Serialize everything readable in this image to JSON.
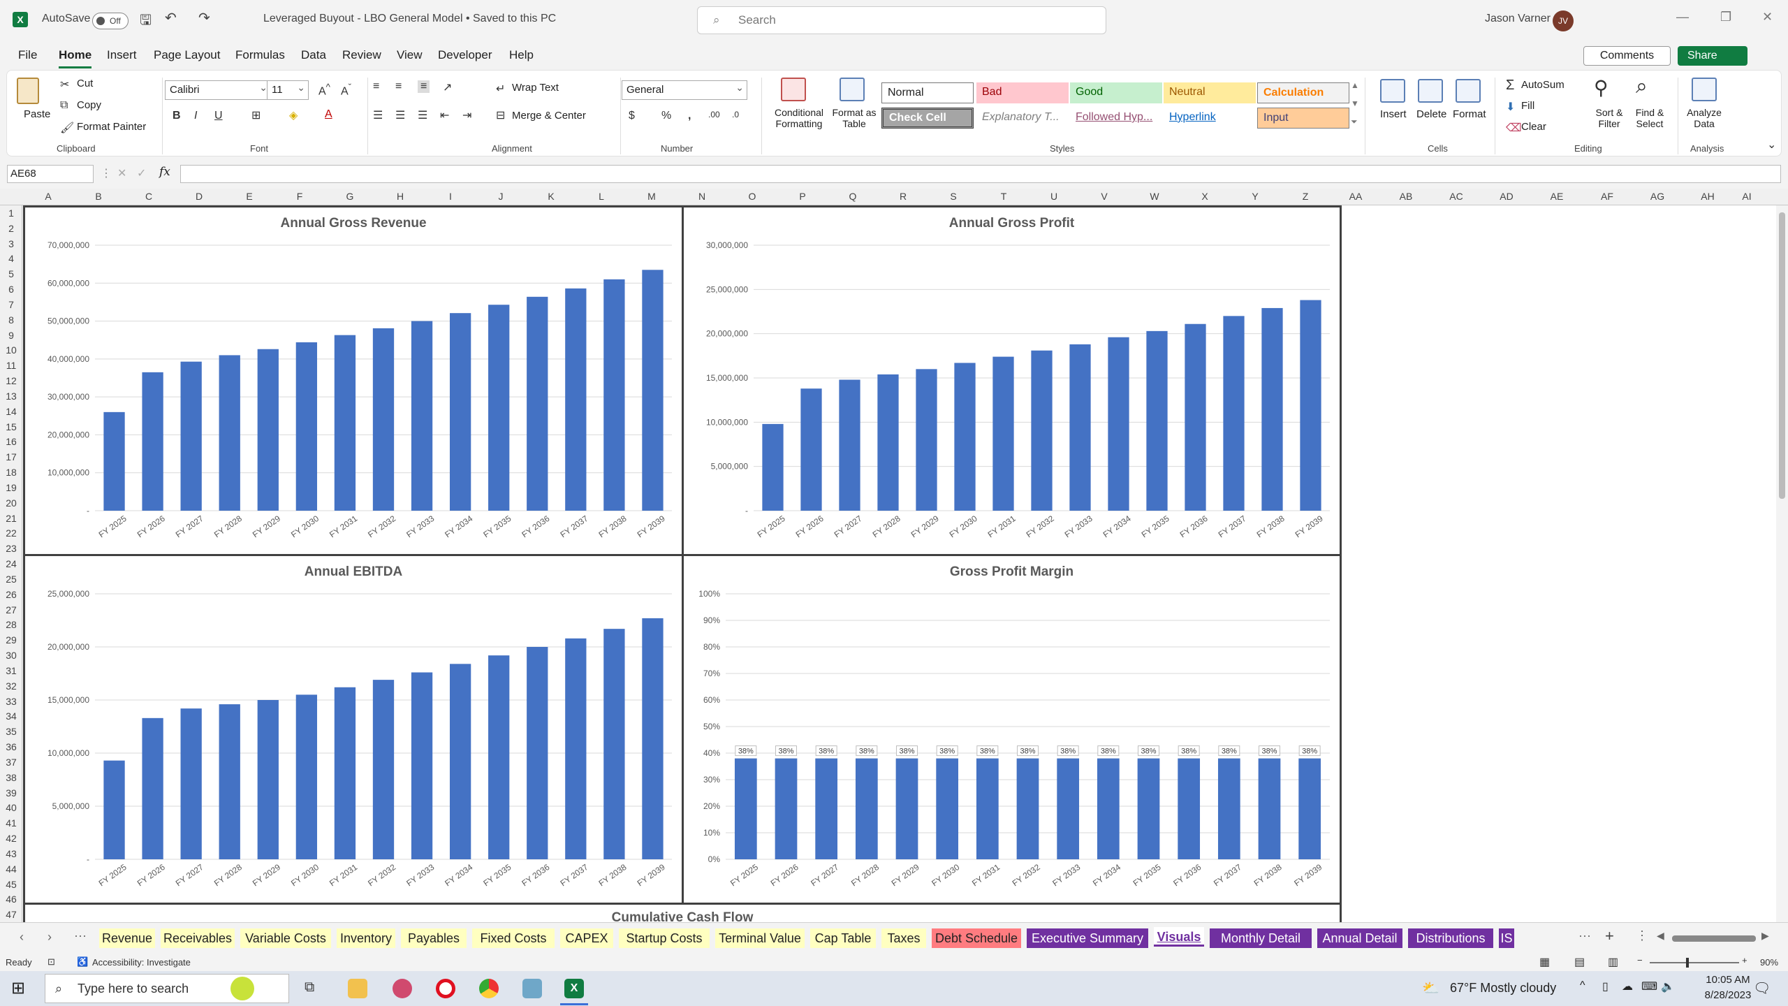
{
  "titlebar": {
    "autosave_label": "AutoSave",
    "autosave_state": "Off",
    "document_title": "Leveraged Buyout - LBO General Model  •  Saved to this PC",
    "search_placeholder": "Search",
    "user_name": "Jason Varner",
    "user_initials": "JV"
  },
  "menu": {
    "items": [
      "File",
      "Home",
      "Insert",
      "Page Layout",
      "Formulas",
      "Data",
      "Review",
      "View",
      "Developer",
      "Help"
    ],
    "active": "Home",
    "comments_label": "Comments",
    "share_label": "Share"
  },
  "ribbon": {
    "clipboard": {
      "paste": "Paste",
      "cut": "Cut",
      "copy": "Copy",
      "format_painter": "Format Painter",
      "group": "Clipboard"
    },
    "font": {
      "name": "Calibri",
      "size": "11",
      "group": "Font"
    },
    "alignment": {
      "wrap_text": "Wrap Text",
      "merge_center": "Merge & Center",
      "group": "Alignment"
    },
    "number": {
      "format": "General",
      "group": "Number"
    },
    "styles": {
      "conditional_formatting": "Conditional Formatting",
      "format_as_table": "Format as Table",
      "cells": [
        "Normal",
        "Bad",
        "Good",
        "Neutral",
        "Calculation",
        "Check Cell",
        "Explanatory T...",
        "Followed Hyp...",
        "Hyperlink",
        "Input"
      ],
      "group": "Styles"
    },
    "cells": {
      "insert": "Insert",
      "delete": "Delete",
      "format": "Format",
      "group": "Cells"
    },
    "editing": {
      "autosum": "AutoSum",
      "fill": "Fill",
      "clear": "Clear",
      "sort_filter": "Sort & Filter",
      "find_select": "Find & Select",
      "group": "Editing"
    },
    "analysis": {
      "analyze_data": "Analyze Data",
      "group": "Analysis"
    }
  },
  "formula_bar": {
    "name_box": "AE68",
    "formula": ""
  },
  "columns": [
    "A",
    "B",
    "C",
    "D",
    "E",
    "F",
    "G",
    "H",
    "I",
    "J",
    "K",
    "L",
    "M",
    "N",
    "O",
    "P",
    "Q",
    "R",
    "S",
    "T",
    "U",
    "V",
    "W",
    "X",
    "Y",
    "Z",
    "AA",
    "AB",
    "AC",
    "AD",
    "AE",
    "AF",
    "AG",
    "AH",
    "AI"
  ],
  "rows": [
    "1",
    "2",
    "3",
    "4",
    "5",
    "6",
    "7",
    "8",
    "9",
    "10",
    "11",
    "12",
    "13",
    "14",
    "15",
    "16",
    "17",
    "18",
    "19",
    "20",
    "21",
    "22",
    "23",
    "24",
    "25",
    "26",
    "27",
    "28",
    "29",
    "30",
    "31",
    "32",
    "33",
    "34",
    "35",
    "36",
    "37",
    "38",
    "39",
    "40",
    "41",
    "42",
    "43",
    "44",
    "45",
    "46",
    "47"
  ],
  "chart_data": [
    {
      "type": "bar",
      "title": "Annual Gross Revenue",
      "categories": [
        "FY 2025",
        "FY 2026",
        "FY 2027",
        "FY 2028",
        "FY 2029",
        "FY 2030",
        "FY 2031",
        "FY 2032",
        "FY 2033",
        "FY 2034",
        "FY 2035",
        "FY 2036",
        "FY 2037",
        "FY 2038",
        "FY 2039"
      ],
      "values": [
        26000000,
        36500000,
        39300000,
        41000000,
        42600000,
        44400000,
        46300000,
        48100000,
        50000000,
        52100000,
        54300000,
        56400000,
        58600000,
        61000000,
        63500000
      ],
      "ylim": [
        0,
        70000000
      ],
      "yticks": [
        "-",
        "10,000,000",
        "20,000,000",
        "30,000,000",
        "40,000,000",
        "50,000,000",
        "60,000,000",
        "70,000,000"
      ],
      "grid": true,
      "color": "#4472c4"
    },
    {
      "type": "bar",
      "title": "Annual Gross Profit",
      "categories": [
        "FY 2025",
        "FY 2026",
        "FY 2027",
        "FY 2028",
        "FY 2029",
        "FY 2030",
        "FY 2031",
        "FY 2032",
        "FY 2033",
        "FY 2034",
        "FY 2035",
        "FY 2036",
        "FY 2037",
        "FY 2038",
        "FY 2039"
      ],
      "values": [
        9800000,
        13800000,
        14800000,
        15400000,
        16000000,
        16700000,
        17400000,
        18100000,
        18800000,
        19600000,
        20300000,
        21100000,
        22000000,
        22900000,
        23800000
      ],
      "ylim": [
        0,
        30000000
      ],
      "yticks": [
        "-",
        "5,000,000",
        "10,000,000",
        "15,000,000",
        "20,000,000",
        "25,000,000",
        "30,000,000"
      ],
      "grid": true,
      "color": "#4472c4"
    },
    {
      "type": "bar",
      "title": "Annual EBITDA",
      "categories": [
        "FY 2025",
        "FY 2026",
        "FY 2027",
        "FY 2028",
        "FY 2029",
        "FY 2030",
        "FY 2031",
        "FY 2032",
        "FY 2033",
        "FY 2034",
        "FY 2035",
        "FY 2036",
        "FY 2037",
        "FY 2038",
        "FY 2039"
      ],
      "values": [
        9300000,
        13300000,
        14200000,
        14600000,
        15000000,
        15500000,
        16200000,
        16900000,
        17600000,
        18400000,
        19200000,
        20000000,
        20800000,
        21700000,
        22700000
      ],
      "ylim": [
        0,
        25000000
      ],
      "yticks": [
        "-",
        "5,000,000",
        "10,000,000",
        "15,000,000",
        "20,000,000",
        "25,000,000"
      ],
      "grid": true,
      "color": "#4472c4"
    },
    {
      "type": "bar",
      "title": "Gross Profit Margin",
      "categories": [
        "FY 2025",
        "FY 2026",
        "FY 2027",
        "FY 2028",
        "FY 2029",
        "FY 2030",
        "FY 2031",
        "FY 2032",
        "FY 2033",
        "FY 2034",
        "FY 2035",
        "FY 2036",
        "FY 2037",
        "FY 2038",
        "FY 2039"
      ],
      "values": [
        38,
        38,
        38,
        38,
        38,
        38,
        38,
        38,
        38,
        38,
        38,
        38,
        38,
        38,
        38
      ],
      "data_labels": [
        "38%",
        "38%",
        "38%",
        "38%",
        "38%",
        "38%",
        "38%",
        "38%",
        "38%",
        "38%",
        "38%",
        "38%",
        "38%",
        "38%",
        "38%"
      ],
      "ylim": [
        0,
        100
      ],
      "yticks": [
        "0%",
        "10%",
        "20%",
        "30%",
        "40%",
        "50%",
        "60%",
        "70%",
        "80%",
        "90%",
        "100%"
      ],
      "grid": true,
      "color": "#4472c4"
    }
  ],
  "partial_chart_title": "Cumulative Cash Flow",
  "tabs": [
    {
      "label": "Revenue",
      "color": "#ffffc0",
      "text": "#222"
    },
    {
      "label": "Receivables",
      "color": "#ffffc0",
      "text": "#222"
    },
    {
      "label": "Variable Costs",
      "color": "#ffffc0",
      "text": "#222"
    },
    {
      "label": "Inventory",
      "color": "#ffffc0",
      "text": "#222"
    },
    {
      "label": "Payables",
      "color": "#ffffc0",
      "text": "#222"
    },
    {
      "label": "Fixed Costs",
      "color": "#ffffc0",
      "text": "#222"
    },
    {
      "label": "CAPEX",
      "color": "#ffffc0",
      "text": "#222"
    },
    {
      "label": "Startup Costs",
      "color": "#ffffc0",
      "text": "#222"
    },
    {
      "label": "Terminal Value",
      "color": "#ffffc0",
      "text": "#222"
    },
    {
      "label": "Cap Table",
      "color": "#ffffc0",
      "text": "#222"
    },
    {
      "label": "Taxes",
      "color": "#ffffc0",
      "text": "#222"
    },
    {
      "label": "Debt Schedule",
      "color": "#ff7c80",
      "text": "#222"
    },
    {
      "label": "Executive Summary",
      "color": "#7030a0",
      "text": "#ffffff"
    },
    {
      "label": "Visuals",
      "color": "#ffffff",
      "text": "#7030a0",
      "active": true
    },
    {
      "label": "Monthly Detail",
      "color": "#7030a0",
      "text": "#ffffff"
    },
    {
      "label": "Annual Detail",
      "color": "#7030a0",
      "text": "#ffffff"
    },
    {
      "label": "Distributions",
      "color": "#7030a0",
      "text": "#ffffff"
    },
    {
      "label": "IS",
      "color": "#7030a0",
      "text": "#ffffff"
    }
  ],
  "status": {
    "ready": "Ready",
    "accessibility": "Accessibility: Investigate",
    "zoom": "90%"
  },
  "taskbar": {
    "search_placeholder": "Type here to search",
    "weather": "67°F  Mostly cloudy",
    "time": "10:05 AM",
    "date": "8/28/2023"
  }
}
